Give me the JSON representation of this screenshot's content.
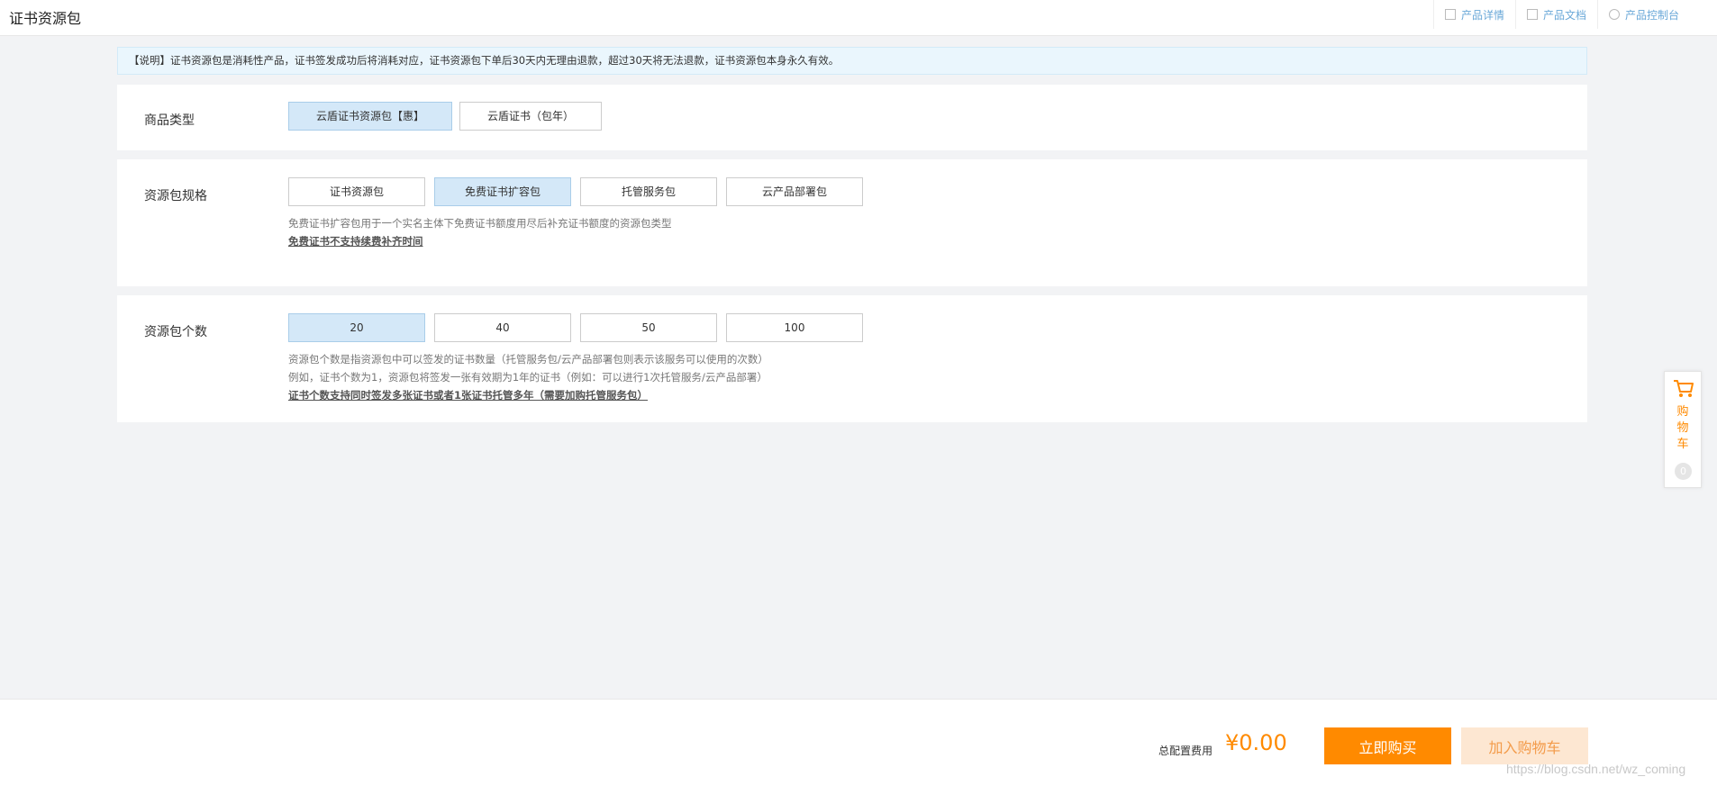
{
  "header": {
    "title": "证书资源包",
    "links": [
      {
        "label": "产品详情",
        "icon": "document-icon"
      },
      {
        "label": "产品文档",
        "icon": "document-icon"
      },
      {
        "label": "产品控制台",
        "icon": "gear-icon"
      }
    ]
  },
  "notice": "【说明】证书资源包是消耗性产品，证书签发成功后将消耗对应，证书资源包下单后30天内无理由退款，超过30天将无法退款，证书资源包本身永久有效。",
  "product_type": {
    "label": "商品类型",
    "options": [
      "云盾证书资源包【惠】",
      "云盾证书（包年）"
    ],
    "selected_index": 0
  },
  "package_spec": {
    "label": "资源包规格",
    "options": [
      "证书资源包",
      "免费证书扩容包",
      "托管服务包",
      "云产品部署包"
    ],
    "selected_index": 1,
    "desc": "免费证书扩容包用于一个实名主体下免费证书额度用尽后补充证书额度的资源包类型",
    "note": "免费证书不支持续费补齐时间"
  },
  "package_count": {
    "label": "资源包个数",
    "options": [
      "20",
      "40",
      "50",
      "100"
    ],
    "selected_index": 0,
    "desc1": "资源包个数是指资源包中可以签发的证书数量（托管服务包/云产品部署包则表示该服务可以使用的次数）",
    "desc2": "例如，证书个数为1，资源包将签发一张有效期为1年的证书（例如：可以进行1次托管服务/云产品部署）",
    "note": "证书个数支持同时签发多张证书或者1张证书托管多年（需要加购托管服务包）"
  },
  "footer": {
    "total_label": "总配置费用",
    "total_price": "¥0.00",
    "buy_label": "立即购买",
    "add_cart_label": "加入购物车",
    "watermark": "https://blog.csdn.net/wz_coming"
  },
  "cart_float": {
    "label": "购物车",
    "count": "0",
    "icon": "cart-icon"
  },
  "colors": {
    "accent": "#ff8a00",
    "selected_bg": "#d4e8f8",
    "notice_bg": "#eaf6fd",
    "link": "#6aa8d8"
  }
}
